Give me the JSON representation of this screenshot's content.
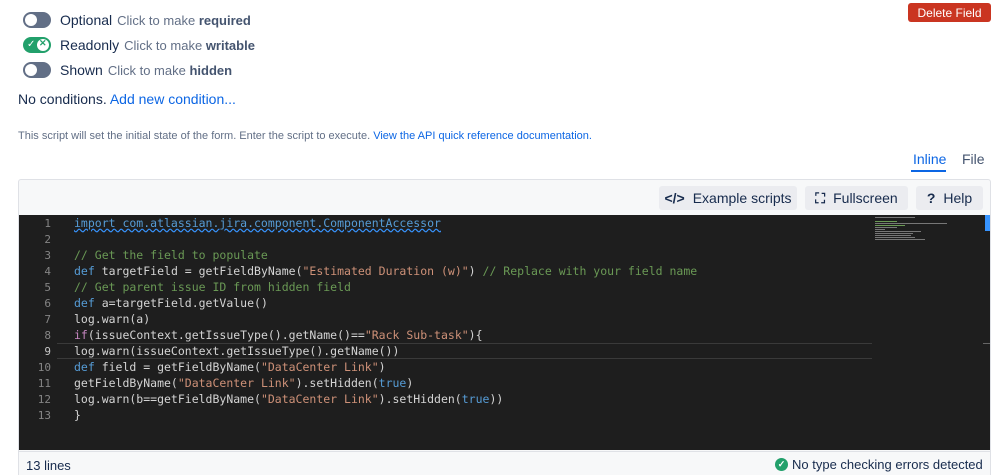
{
  "toggles": [
    {
      "label": "Optional",
      "hint": "Click to make",
      "hint_strong": "required",
      "on": false
    },
    {
      "label": "Readonly",
      "hint": "Click to make",
      "hint_strong": "writable",
      "on": true
    },
    {
      "label": "Shown",
      "hint": "Click to make",
      "hint_strong": "hidden",
      "on": false
    }
  ],
  "delete_button": "Delete Field",
  "conditions": {
    "text": "No conditions.",
    "link": "Add new condition..."
  },
  "script_description": {
    "text": "This script will set the initial state of the form. Enter the script to execute.",
    "link": "View the API quick reference documentation."
  },
  "tabs": {
    "inline": "Inline",
    "file": "File",
    "active": "Inline"
  },
  "toolbar": {
    "examples": "Example scripts",
    "fullscreen": "Fullscreen",
    "help": "Help"
  },
  "icons": {
    "examples": "code-icon",
    "fullscreen": "fullscreen-icon",
    "help": "question-icon",
    "status": "check-circle-icon"
  },
  "colors": {
    "accent": "#0c66e4",
    "danger": "#ca3521",
    "success": "#22a06b",
    "editor_bg": "#1e1e1e"
  },
  "editor": {
    "line_numbers": [
      "1",
      "2",
      "3",
      "4",
      "5",
      "6",
      "7",
      "8",
      "9",
      "10",
      "11",
      "12",
      "13"
    ],
    "active_line": "9",
    "code_lines": [
      "import com.atlassian.jira.component.ComponentAccessor",
      "",
      "// Get the field to populate",
      "def targetField = getFieldByName(\"Estimated Duration (w)\") // Replace with your field name",
      "// Get parent issue ID from hidden field",
      "def a=targetField.getValue()",
      "log.warn(a)",
      "if(issueContext.getIssueType().getName()==\"Rack Sub-task\"){",
      "log.warn(issueContext.getIssueType().getName())",
      "def field = getFieldByName(\"DataCenter Link\")",
      "getFieldByName(\"DataCenter Link\").setHidden(true)",
      "log.warn(b==getFieldByName(\"DataCenter Link\").setHidden(true))",
      "}"
    ]
  },
  "status": {
    "line_count": "13 lines",
    "type_check": "No type checking errors detected"
  }
}
